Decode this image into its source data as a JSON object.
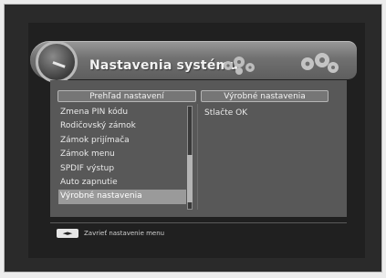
{
  "header": {
    "title": "Nastavenia systému"
  },
  "left_column": {
    "heading": "Prehľad nastavení",
    "items": [
      {
        "label": "Zmena PIN kódu",
        "selected": false
      },
      {
        "label": "Rodičovský zámok",
        "selected": false
      },
      {
        "label": "Zámok prijímača",
        "selected": false
      },
      {
        "label": "Zámok menu",
        "selected": false
      },
      {
        "label": "SPDIF výstup",
        "selected": false
      },
      {
        "label": "Auto zapnutie",
        "selected": false
      },
      {
        "label": "Výrobné nastavenia",
        "selected": true
      }
    ]
  },
  "right_column": {
    "heading": "Výrobné nastavenia",
    "value": "Stlačte OK"
  },
  "footer": {
    "key_icon": "left-right-arrows",
    "key_label": "◄►",
    "hint": "Zavrieť nastavenie menu"
  },
  "colors": {
    "panel": "#585858",
    "selected_row": "#9a9a9a",
    "header_plate": "#707070"
  }
}
